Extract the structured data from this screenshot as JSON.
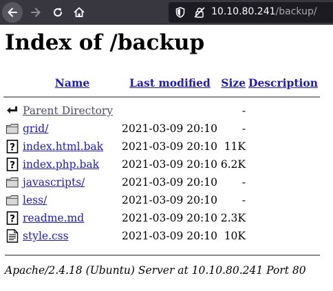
{
  "browser": {
    "url_host": "10.10.80.241",
    "url_path": "/backup/",
    "icons": [
      "back-arrow-icon",
      "forward-arrow-icon",
      "reload-icon",
      "home-icon",
      "shield-icon",
      "insecure-lock-icon"
    ]
  },
  "page": {
    "title": "Index of /backup",
    "columns": {
      "name": "Name",
      "last_modified": "Last modified",
      "size": "Size",
      "description": "Description"
    },
    "entries": [
      {
        "icon": "back-icon",
        "name": "Parent Directory",
        "modified": "",
        "size": "-",
        "desc": ""
      },
      {
        "icon": "folder-icon",
        "name": "grid/",
        "modified": "2021-03-09 20:10",
        "size": "-",
        "desc": ""
      },
      {
        "icon": "unknown-file-icon",
        "name": "index.html.bak",
        "modified": "2021-03-09 20:10",
        "size": "11K",
        "desc": ""
      },
      {
        "icon": "unknown-file-icon",
        "name": "index.php.bak",
        "modified": "2021-03-09 20:10",
        "size": "6.2K",
        "desc": ""
      },
      {
        "icon": "folder-icon",
        "name": "javascripts/",
        "modified": "2021-03-09 20:10",
        "size": "-",
        "desc": ""
      },
      {
        "icon": "folder-icon",
        "name": "less/",
        "modified": "2021-03-09 20:10",
        "size": "-",
        "desc": ""
      },
      {
        "icon": "unknown-file-icon",
        "name": "readme.md",
        "modified": "2021-03-09 20:10",
        "size": "2.3K",
        "desc": ""
      },
      {
        "icon": "text-file-icon",
        "name": "style.css",
        "modified": "2021-03-09 20:10",
        "size": "10K",
        "desc": ""
      }
    ],
    "footer": "Apache/2.4.18 (Ubuntu) Server at 10.10.80.241 Port 80"
  },
  "colors": {
    "toolbar_bg": "#38373f",
    "urlbar_bg": "#1c1b22",
    "link": "#1f1bb3"
  }
}
